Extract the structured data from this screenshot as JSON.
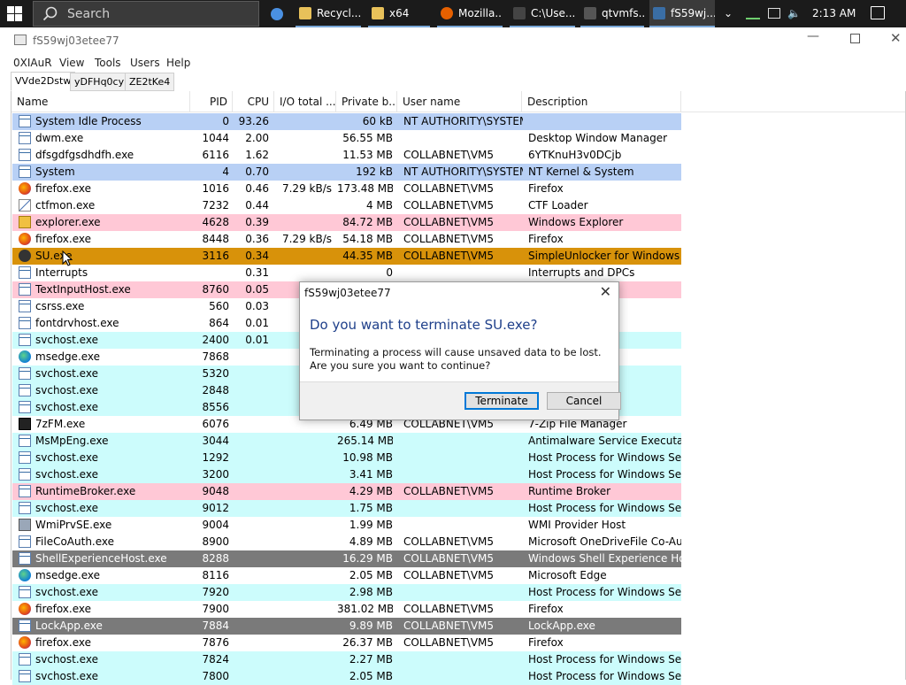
{
  "taskbar": {
    "search_label": "Search",
    "items": [
      {
        "label": "",
        "icon": "chrome-icon",
        "color": "#4a90e2"
      },
      {
        "label": "Recycl...",
        "icon": "folder-icon",
        "color": "#e8c15a"
      },
      {
        "label": "x64",
        "icon": "folder-icon",
        "color": "#e8c15a"
      },
      {
        "label": "Mozilla...",
        "icon": "firefox-icon",
        "color": "#e66000"
      },
      {
        "label": "C:\\Use...",
        "icon": "cmd-icon",
        "color": "#444444"
      },
      {
        "label": "qtvmfs...",
        "icon": "app-s-icon",
        "color": "#555555"
      },
      {
        "label": "fS59wj...",
        "icon": "system-informer-icon",
        "color": "#3a6ea5"
      }
    ],
    "clock": "2:13 AM"
  },
  "window": {
    "title": "fS59wj03etee77",
    "menu": [
      "0XIAuR",
      "View",
      "Tools",
      "Users",
      "Help"
    ],
    "tabs": [
      "VVde2Dstw",
      "yDFHq0cy",
      "ZE2tKe4"
    ]
  },
  "columns": [
    "Name",
    "PID",
    "CPU",
    "I/O total ...",
    "Private b...",
    "User name",
    "Description"
  ],
  "colors": {
    "system": "#b8d0f5",
    "service": "#ccfcfc",
    "own": "#ffc8d6",
    "selected": "#d8920a",
    "suspended": "#7a7a7a",
    "none": "#ffffff"
  },
  "rows": [
    {
      "name": "System Idle Process",
      "pid": "0",
      "cpu": "93.26",
      "io": "",
      "priv": "60 kB",
      "user": "NT AUTHORITY\\SYSTEM",
      "desc": "",
      "bg": "system",
      "icon": "process-icon"
    },
    {
      "name": "dwm.exe",
      "pid": "1044",
      "cpu": "2.00",
      "io": "",
      "priv": "56.55 MB",
      "user": "",
      "desc": "Desktop Window Manager",
      "bg": "none",
      "icon": "process-icon"
    },
    {
      "name": "dfsgdfgsdhdfh.exe",
      "pid": "6116",
      "cpu": "1.62",
      "io": "",
      "priv": "11.53 MB",
      "user": "COLLABNET\\VM5",
      "desc": "6YTKnuH3v0DCjb",
      "bg": "none",
      "icon": "process-icon"
    },
    {
      "name": "System",
      "pid": "4",
      "cpu": "0.70",
      "io": "",
      "priv": "192 kB",
      "user": "NT AUTHORITY\\SYSTEM",
      "desc": "NT Kernel & System",
      "bg": "system",
      "icon": "process-icon"
    },
    {
      "name": "firefox.exe",
      "pid": "1016",
      "cpu": "0.46",
      "io": "7.29 kB/s",
      "priv": "173.48 MB",
      "user": "COLLABNET\\VM5",
      "desc": "Firefox",
      "bg": "none",
      "icon": "firefox-icon"
    },
    {
      "name": "ctfmon.exe",
      "pid": "7232",
      "cpu": "0.44",
      "io": "",
      "priv": "4 MB",
      "user": "COLLABNET\\VM5",
      "desc": "CTF Loader",
      "bg": "none",
      "icon": "ctfmon-icon"
    },
    {
      "name": "explorer.exe",
      "pid": "4628",
      "cpu": "0.39",
      "io": "",
      "priv": "84.72 MB",
      "user": "COLLABNET\\VM5",
      "desc": "Windows Explorer",
      "bg": "own",
      "icon": "explorer-icon"
    },
    {
      "name": "firefox.exe",
      "pid": "8448",
      "cpu": "0.36",
      "io": "7.29 kB/s",
      "priv": "54.18 MB",
      "user": "COLLABNET\\VM5",
      "desc": "Firefox",
      "bg": "none",
      "icon": "firefox-icon"
    },
    {
      "name": "SU.exe",
      "pid": "3116",
      "cpu": "0.34",
      "io": "",
      "priv": "44.35 MB",
      "user": "COLLABNET\\VM5",
      "desc": "SimpleUnlocker for Windows",
      "bg": "selected",
      "icon": "su-icon"
    },
    {
      "name": "Interrupts",
      "pid": "",
      "cpu": "0.31",
      "io": "",
      "priv": "0",
      "user": "",
      "desc": "Interrupts and DPCs",
      "bg": "none",
      "icon": "process-icon"
    },
    {
      "name": "TextInputHost.exe",
      "pid": "8760",
      "cpu": "0.05",
      "io": "",
      "priv": "",
      "user": "",
      "desc": "",
      "bg": "own",
      "icon": "process-icon"
    },
    {
      "name": "csrss.exe",
      "pid": "560",
      "cpu": "0.03",
      "io": "",
      "priv": "",
      "user": "",
      "desc": "ne Process",
      "bg": "none",
      "icon": "process-icon"
    },
    {
      "name": "fontdrvhost.exe",
      "pid": "864",
      "cpu": "0.01",
      "io": "",
      "priv": "",
      "user": "",
      "desc": "er Host",
      "bg": "none",
      "icon": "process-icon"
    },
    {
      "name": "svchost.exe",
      "pid": "2400",
      "cpu": "0.01",
      "io": "",
      "priv": "",
      "user": "",
      "desc": "ndows Ser...",
      "bg": "service",
      "icon": "process-icon"
    },
    {
      "name": "msedge.exe",
      "pid": "7868",
      "cpu": "",
      "io": "",
      "priv": "",
      "user": "",
      "desc": "",
      "bg": "none",
      "icon": "edge-icon"
    },
    {
      "name": "svchost.exe",
      "pid": "5320",
      "cpu": "",
      "io": "",
      "priv": "",
      "user": "",
      "desc": "ndows Ser...",
      "bg": "service",
      "icon": "process-icon"
    },
    {
      "name": "svchost.exe",
      "pid": "2848",
      "cpu": "",
      "io": "",
      "priv": "",
      "user": "",
      "desc": "ndows Ser...",
      "bg": "service",
      "icon": "process-icon"
    },
    {
      "name": "svchost.exe",
      "pid": "8556",
      "cpu": "",
      "io": "",
      "priv": "",
      "user": "",
      "desc": "ndows Ser...",
      "bg": "service",
      "icon": "process-icon"
    },
    {
      "name": "7zFM.exe",
      "pid": "6076",
      "cpu": "",
      "io": "",
      "priv": "6.49 MB",
      "user": "COLLABNET\\VM5",
      "desc": "7-Zip File Manager",
      "bg": "none",
      "icon": "7zip-icon"
    },
    {
      "name": "MsMpEng.exe",
      "pid": "3044",
      "cpu": "",
      "io": "",
      "priv": "265.14 MB",
      "user": "",
      "desc": "Antimalware Service Executable",
      "bg": "service",
      "icon": "process-icon"
    },
    {
      "name": "svchost.exe",
      "pid": "1292",
      "cpu": "",
      "io": "",
      "priv": "10.98 MB",
      "user": "",
      "desc": "Host Process for Windows Ser...",
      "bg": "service",
      "icon": "process-icon"
    },
    {
      "name": "svchost.exe",
      "pid": "3200",
      "cpu": "",
      "io": "",
      "priv": "3.41 MB",
      "user": "",
      "desc": "Host Process for Windows Ser...",
      "bg": "service",
      "icon": "process-icon"
    },
    {
      "name": "RuntimeBroker.exe",
      "pid": "9048",
      "cpu": "",
      "io": "",
      "priv": "4.29 MB",
      "user": "COLLABNET\\VM5",
      "desc": "Runtime Broker",
      "bg": "own",
      "icon": "process-icon"
    },
    {
      "name": "svchost.exe",
      "pid": "9012",
      "cpu": "",
      "io": "",
      "priv": "1.75 MB",
      "user": "",
      "desc": "Host Process for Windows Ser...",
      "bg": "service",
      "icon": "process-icon"
    },
    {
      "name": "WmiPrvSE.exe",
      "pid": "9004",
      "cpu": "",
      "io": "",
      "priv": "1.99 MB",
      "user": "",
      "desc": "WMI Provider Host",
      "bg": "none",
      "icon": "wmi-icon"
    },
    {
      "name": "FileCoAuth.exe",
      "pid": "8900",
      "cpu": "",
      "io": "",
      "priv": "4.89 MB",
      "user": "COLLABNET\\VM5",
      "desc": "Microsoft OneDriveFile Co-Au...",
      "bg": "none",
      "icon": "process-icon"
    },
    {
      "name": "ShellExperienceHost.exe",
      "pid": "8288",
      "cpu": "",
      "io": "",
      "priv": "16.29 MB",
      "user": "COLLABNET\\VM5",
      "desc": "Windows Shell Experience Host",
      "bg": "suspended",
      "icon": "process-icon"
    },
    {
      "name": "msedge.exe",
      "pid": "8116",
      "cpu": "",
      "io": "",
      "priv": "2.05 MB",
      "user": "COLLABNET\\VM5",
      "desc": "Microsoft Edge",
      "bg": "none",
      "icon": "edge-icon"
    },
    {
      "name": "svchost.exe",
      "pid": "7920",
      "cpu": "",
      "io": "",
      "priv": "2.98 MB",
      "user": "",
      "desc": "Host Process for Windows Ser...",
      "bg": "service",
      "icon": "process-icon"
    },
    {
      "name": "firefox.exe",
      "pid": "7900",
      "cpu": "",
      "io": "",
      "priv": "381.02 MB",
      "user": "COLLABNET\\VM5",
      "desc": "Firefox",
      "bg": "none",
      "icon": "firefox-icon"
    },
    {
      "name": "LockApp.exe",
      "pid": "7884",
      "cpu": "",
      "io": "",
      "priv": "9.89 MB",
      "user": "COLLABNET\\VM5",
      "desc": "LockApp.exe",
      "bg": "suspended",
      "icon": "process-icon"
    },
    {
      "name": "firefox.exe",
      "pid": "7876",
      "cpu": "",
      "io": "",
      "priv": "26.37 MB",
      "user": "COLLABNET\\VM5",
      "desc": "Firefox",
      "bg": "none",
      "icon": "firefox-icon"
    },
    {
      "name": "svchost.exe",
      "pid": "7824",
      "cpu": "",
      "io": "",
      "priv": "2.27 MB",
      "user": "",
      "desc": "Host Process for Windows Ser...",
      "bg": "service",
      "icon": "process-icon"
    },
    {
      "name": "svchost.exe",
      "pid": "7800",
      "cpu": "",
      "io": "",
      "priv": "2.05 MB",
      "user": "",
      "desc": "Host Process for Windows Ser...",
      "bg": "service",
      "icon": "process-icon"
    }
  ],
  "dialog": {
    "title": "fS59wj03etee77",
    "heading": "Do you want to terminate SU.exe?",
    "message": "Terminating a process will cause unsaved data to be lost. Are you sure you want to continue?",
    "terminate_label": "Terminate",
    "cancel_label": "Cancel"
  }
}
